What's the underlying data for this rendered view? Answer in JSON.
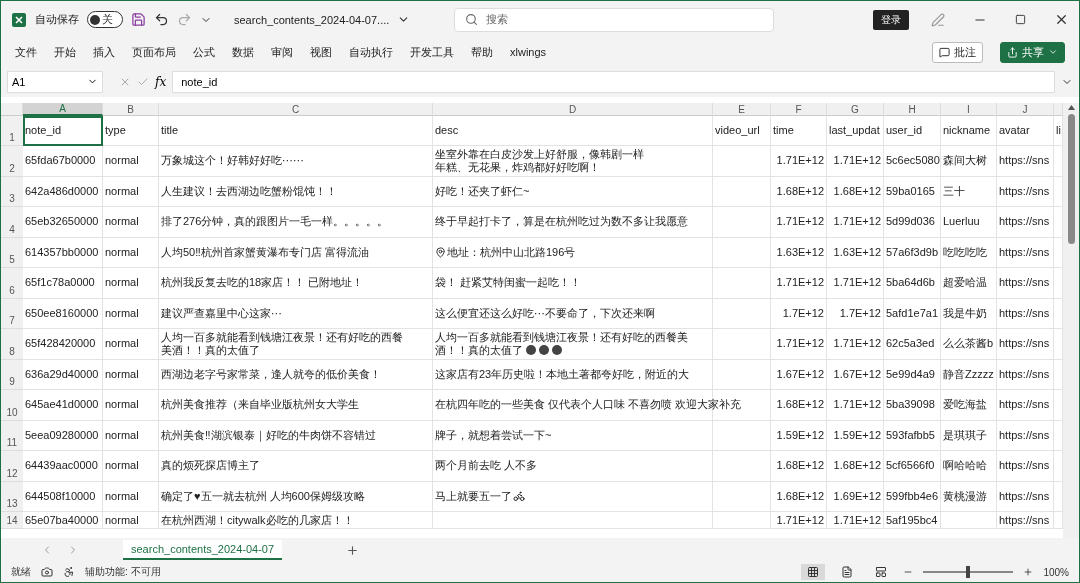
{
  "app": {
    "autosave_label": "自动保存",
    "autosave": {
      "on": false,
      "label": "关"
    },
    "file_title": "search_contents_2024-04-07....",
    "search": {
      "placeholder": "搜索"
    },
    "login": "登录"
  },
  "menu": [
    "文件",
    "开始",
    "插入",
    "页面布局",
    "公式",
    "数据",
    "审阅",
    "视图",
    "自动执行",
    "开发工具",
    "帮助",
    "xlwings"
  ],
  "comment_button": "批注",
  "share_button": "共享",
  "formula_bar": {
    "name_box": "A1",
    "fx_label": "fx",
    "value": "note_id"
  },
  "column_letters": [
    "A",
    "B",
    "C",
    "D",
    "E",
    "F",
    "G",
    "H",
    "I",
    "J"
  ],
  "header_row": [
    "note_id",
    "type",
    "title",
    "desc",
    "video_url",
    "time",
    "last_updat",
    "user_id",
    "nickname",
    "avatar",
    "li"
  ],
  "rows": [
    {
      "num": "1",
      "kind": "header"
    },
    {
      "num": "2",
      "note_id": "65fda67b0000",
      "type": "normal",
      "title": [
        "万象城这个！好韩好好吃⋯⋯"
      ],
      "desc": [
        {
          "text": "坐室外靠在白皮沙发上好舒服，像韩剧一样"
        },
        {
          "text": "年糕、无花果，炸鸡都好好吃啊！"
        }
      ],
      "time": "1.71E+12",
      "last_update": "1.71E+12",
      "user_id": "5c6ec5080",
      "nickname": "森间大树",
      "avatar": "https://sns"
    },
    {
      "num": "3",
      "note_id": "642a486d0000",
      "type": "normal",
      "title": [
        "人生建议！去西湖边吃蟹粉馄饨！！"
      ],
      "desc": [
        {
          "text": "好吃！还夹了虾仁~"
        }
      ],
      "time": "1.68E+12",
      "last_update": "1.68E+12",
      "user_id": "59ba0165",
      "nickname": "三十",
      "avatar": "https://sns"
    },
    {
      "num": "4",
      "note_id": "65eb32650000",
      "type": "normal",
      "title": [
        "排了276分钟，真的跟图片一毛一样。。。。。"
      ],
      "desc": [
        {
          "text": "终于早起打卡了，算是在杭州吃过为数不多让我愿意"
        }
      ],
      "time": "1.71E+12",
      "last_update": "1.71E+12",
      "user_id": "5d99d036",
      "nickname": "Luerluu",
      "avatar": "https://sns"
    },
    {
      "num": "5",
      "note_id": "614357bb0000",
      "type": "normal",
      "title": [
        "人均50‼杭州首家蟹黄瀑布专门店 富得流油"
      ],
      "desc": [
        {
          "text": "地址：杭州中山北路196号",
          "lead": {
            "kind": "pin"
          }
        }
      ],
      "time": "1.63E+12",
      "last_update": "1.63E+12",
      "user_id": "57a6f3d9b",
      "nickname": "吃吃吃吃",
      "avatar": "https://sns"
    },
    {
      "num": "6",
      "note_id": "65f1c78a0000",
      "type": "normal",
      "title": [
        "杭州我反复去吃的18家店！！ 已附地址！"
      ],
      "desc": [
        {
          "text": "袋！ 赶紧艾特闺蜜一起吃！！"
        }
      ],
      "time": "1.71E+12",
      "last_update": "1.71E+12",
      "user_id": "5ba64d6b",
      "nickname": "超爱哈温",
      "avatar": "https://sns"
    },
    {
      "num": "7",
      "note_id": "650ee8160000",
      "type": "normal",
      "title": [
        "建议严查嘉里中心这家⋯"
      ],
      "desc": [
        {
          "text": "这么便宜还这么好吃⋯不要命了，下次还来啊"
        }
      ],
      "time": "1.7E+12",
      "last_update": "1.7E+12",
      "user_id": "5afd1e7a1",
      "nickname": "我是牛奶",
      "avatar": "https://sns"
    },
    {
      "num": "8",
      "note_id": "65f428420000",
      "type": "normal",
      "title": [
        "人均一百多就能看到钱塘江夜景！还有好吃的西餐",
        "美酒！！真的太值了"
      ],
      "desc": [
        {
          "text": "人均一百多就能看到钱塘江夜景！还有好吃的西餐美"
        },
        {
          "text": "酒！！真的太值了",
          "trail": [
            {
              "kind": "emoji"
            },
            {
              "kind": "emoji"
            },
            {
              "kind": "emoji"
            }
          ]
        }
      ],
      "time": "1.71E+12",
      "last_update": "1.71E+12",
      "user_id": "62c5a3ed",
      "nickname": "么么茶酱b",
      "avatar": "https://sns"
    },
    {
      "num": "9",
      "note_id": "636a29d40000",
      "type": "normal",
      "title": [
        "西湖边老字号家常菜，逢人就夸的低价美食！"
      ],
      "desc": [
        {
          "text": "这家店有23年历史啦！本地土著都夸好吃，附近的大"
        }
      ],
      "time": "1.67E+12",
      "last_update": "1.67E+12",
      "user_id": "5e99d4a9",
      "nickname": "静音Zzzzz",
      "avatar": "https://sns"
    },
    {
      "num": "10",
      "note_id": "645ae41d0000",
      "type": "normal",
      "title": [
        "杭州美食推荐（来自毕业版杭州女大学生"
      ],
      "desc": [
        {
          "text": "在杭四年吃的一些美食 仅代表个人口味 不喜勿喷 欢迎大家补充"
        }
      ],
      "time": "1.68E+12",
      "last_update": "1.71E+12",
      "user_id": "5ba39098",
      "nickname": "爱吃海盐",
      "avatar": "https://sns"
    },
    {
      "num": "11",
      "note_id": "5eea09280000",
      "type": "normal",
      "title": [
        "杭州美食‼湖滨银泰｜好吃的牛肉饼不容错过"
      ],
      "desc": [
        {
          "text": "牌子，就想着尝试一下~"
        }
      ],
      "time": "1.59E+12",
      "last_update": "1.59E+12",
      "user_id": "593fafbb5",
      "nickname": "是琪琪子",
      "avatar": "https://sns"
    },
    {
      "num": "12",
      "note_id": "64439aac0000",
      "type": "normal",
      "title": [
        "真的烦死探店博主了"
      ],
      "desc": [
        {
          "text": "两个月前去吃 人不多"
        }
      ],
      "time": "1.68E+12",
      "last_update": "1.68E+12",
      "user_id": "5cf6566f0",
      "nickname": "啊哈哈哈",
      "avatar": "https://sns"
    },
    {
      "num": "13",
      "note_id": "644508f10000",
      "type": "normal",
      "title": [
        "确定了♥五一就去杭州 人均600保姆级攻略"
      ],
      "desc": [
        {
          "text": "马上就要五一了",
          "trail": [
            {
              "kind": "scooter"
            }
          ]
        }
      ],
      "time": "1.68E+12",
      "last_update": "1.69E+12",
      "user_id": "599fbb4e6",
      "nickname": "黄桃漫游",
      "avatar": "https://sns"
    },
    {
      "num": "14",
      "kind": "partial",
      "note_id": "65e07ba40000",
      "type": "normal",
      "title": [
        "在杭州西湖！citywalk必吃的几家店！！"
      ],
      "desc": [],
      "time": "1.71E+12",
      "last_update": "1.71E+12",
      "user_id": "5af195bc4",
      "avatar": "https://sns"
    }
  ],
  "sheet_tabs": [
    {
      "label": "search_contents_2024-04-07",
      "selected": true
    }
  ],
  "status": {
    "ready": "就绪",
    "accessibility": "辅助功能: 不可用",
    "views": [
      {
        "kind": "normal",
        "selected": true
      },
      {
        "kind": "layout",
        "selected": false
      },
      {
        "kind": "pagebreak",
        "selected": false
      }
    ],
    "zoom_slider": {
      "level": 0.5
    },
    "zoom": "100%"
  }
}
